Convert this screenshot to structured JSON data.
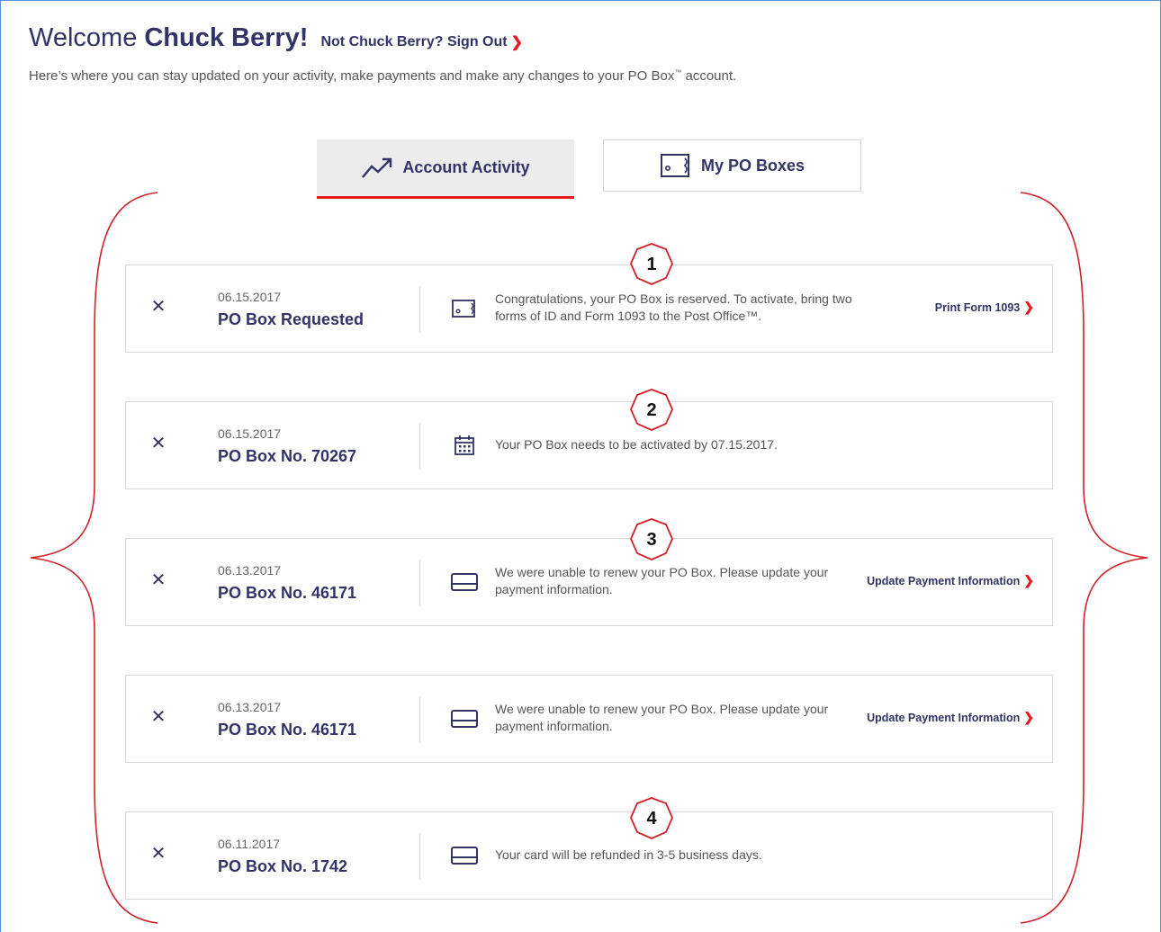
{
  "header": {
    "welcome": "Welcome",
    "name": "Chuck Berry!",
    "signout": "Not Chuck Berry? Sign Out",
    "subtitle_main": "Here’s where you can stay updated on your activity, make payments and make any changes to your PO Box",
    "subtitle_tm": "™",
    "subtitle_end": " account."
  },
  "tabs": [
    {
      "label": "Account Activity",
      "icon": "trend-line-icon",
      "active": true
    },
    {
      "label": "My PO Boxes",
      "icon": "po-box-icon",
      "active": false
    }
  ],
  "cards": [
    {
      "date": "06.15.2017",
      "title": "PO Box Requested",
      "icon": "po-box-icon",
      "message": "Congratulations, your PO Box is reserved. To activate, bring two forms of ID and Form 1093 to the Post Office™.",
      "action": "Print Form 1093",
      "badge": "1"
    },
    {
      "date": "06.15.2017",
      "title": "PO Box No. 70267",
      "icon": "calendar-icon",
      "message": "Your PO Box needs to be activated by 07.15.2017.",
      "action": "",
      "badge": "2"
    },
    {
      "date": "06.13.2017",
      "title": "PO Box No. 46171",
      "icon": "credit-card-icon",
      "message": "We were unable to renew your PO Box. Please update your payment information.",
      "action": "Update Payment Information",
      "badge": "3"
    },
    {
      "date": "06.13.2017",
      "title": "PO Box No. 46171",
      "icon": "credit-card-icon",
      "message": "We were unable to renew your PO Box. Please update your payment information.",
      "action": "Update Payment Information",
      "badge": ""
    },
    {
      "date": "06.11.2017",
      "title": "PO Box No. 1742",
      "icon": "credit-card-icon",
      "message": "Your card will be refunded in 3-5 business days.",
      "action": "",
      "badge": "4"
    }
  ],
  "colors": {
    "brand_navy": "#333366",
    "accent_red": "#e71921",
    "annotation_red": "#d0202a"
  }
}
